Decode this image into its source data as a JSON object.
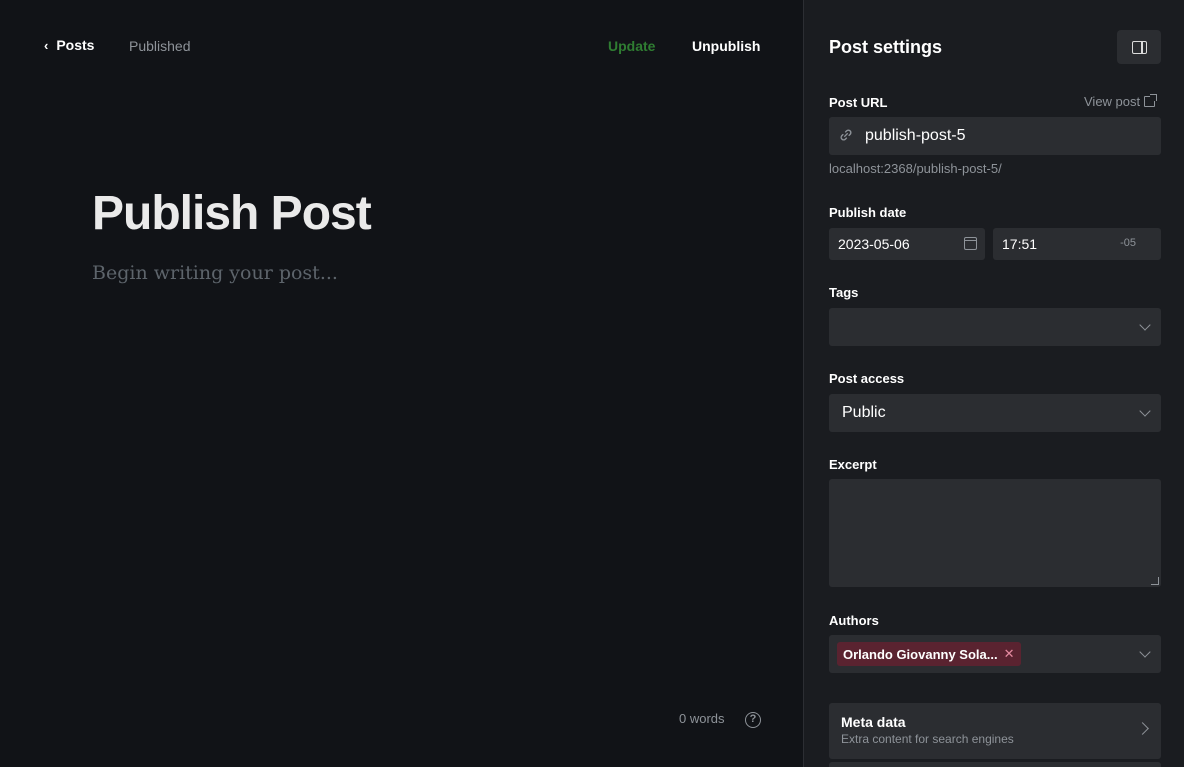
{
  "editor": {
    "back_label": "Posts",
    "status": "Published",
    "update_label": "Update",
    "unpublish_label": "Unpublish",
    "title": "Publish Post",
    "body_placeholder": "Begin writing your post...",
    "word_count": "0 words",
    "help_glyph": "?"
  },
  "settings": {
    "title": "Post settings",
    "post_url": {
      "label": "Post URL",
      "view_post_label": "View post",
      "value": "publish-post-5",
      "hint": "localhost:2368/publish-post-5/"
    },
    "publish_date": {
      "label": "Publish date",
      "date": "2023-05-06",
      "time": "17:51",
      "tz": "-05"
    },
    "tags": {
      "label": "Tags",
      "value": ""
    },
    "post_access": {
      "label": "Post access",
      "value": "Public"
    },
    "excerpt": {
      "label": "Excerpt",
      "value": ""
    },
    "authors": {
      "label": "Authors",
      "items": [
        "Orlando Giovanny Sola..."
      ]
    },
    "meta_data": {
      "title": "Meta data",
      "subtitle": "Extra content for search engines"
    }
  },
  "colors": {
    "background": "#111317",
    "panel": "#1a1c20",
    "field": "#2b2d31",
    "update_green": "#2f7d32",
    "author_tag": "#5a2330"
  }
}
